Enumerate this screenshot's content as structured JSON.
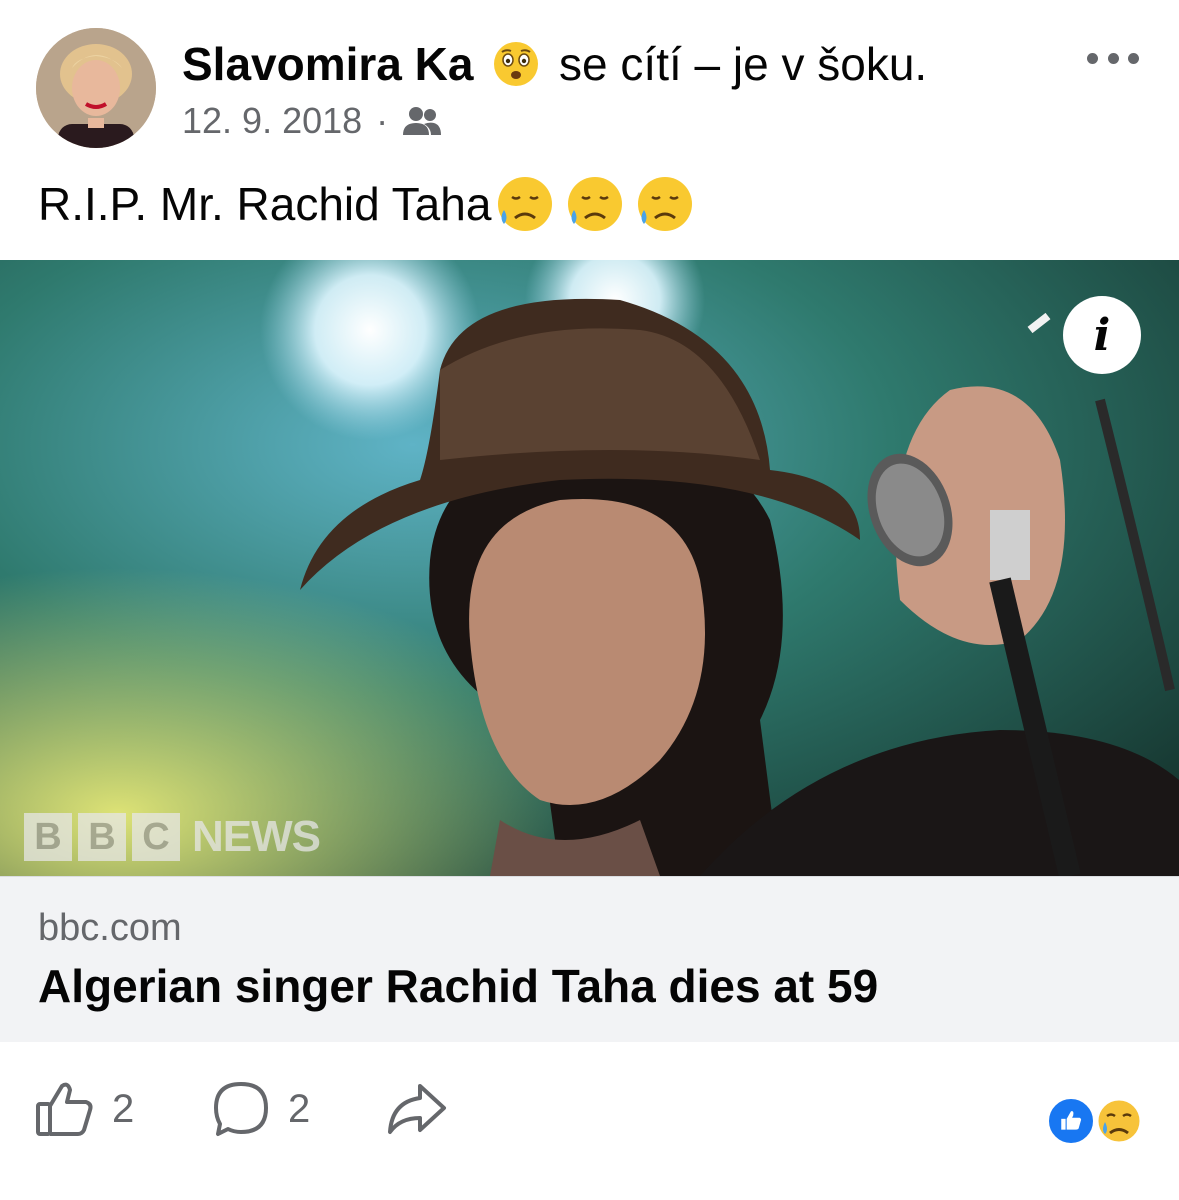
{
  "post": {
    "author": "Slavomira Ka",
    "feeling_emoji": "shocked-face-icon",
    "feeling_text": "se cítí – je v šoku.",
    "date": "12. 9. 2018",
    "dot": "·",
    "audience_icon": "friends-icon",
    "text": "R.I.P. Mr. Rachid Taha",
    "text_emojis": [
      "sad-sweat-face-icon",
      "sad-sweat-face-icon",
      "sad-sweat-face-icon"
    ]
  },
  "link": {
    "brand": [
      "B",
      "B",
      "C"
    ],
    "brand_word": "NEWS",
    "info_label": "i",
    "domain": "bbc.com",
    "headline": "Algerian singer Rachid Taha dies at 59"
  },
  "actions": {
    "like_count": "2",
    "comment_count": "2",
    "reactions": [
      "like-reaction-icon",
      "sad-reaction-icon"
    ]
  },
  "colors": {
    "accent": "#1877f2",
    "meta_gray": "#65676b",
    "link_bg": "#f2f3f5"
  }
}
